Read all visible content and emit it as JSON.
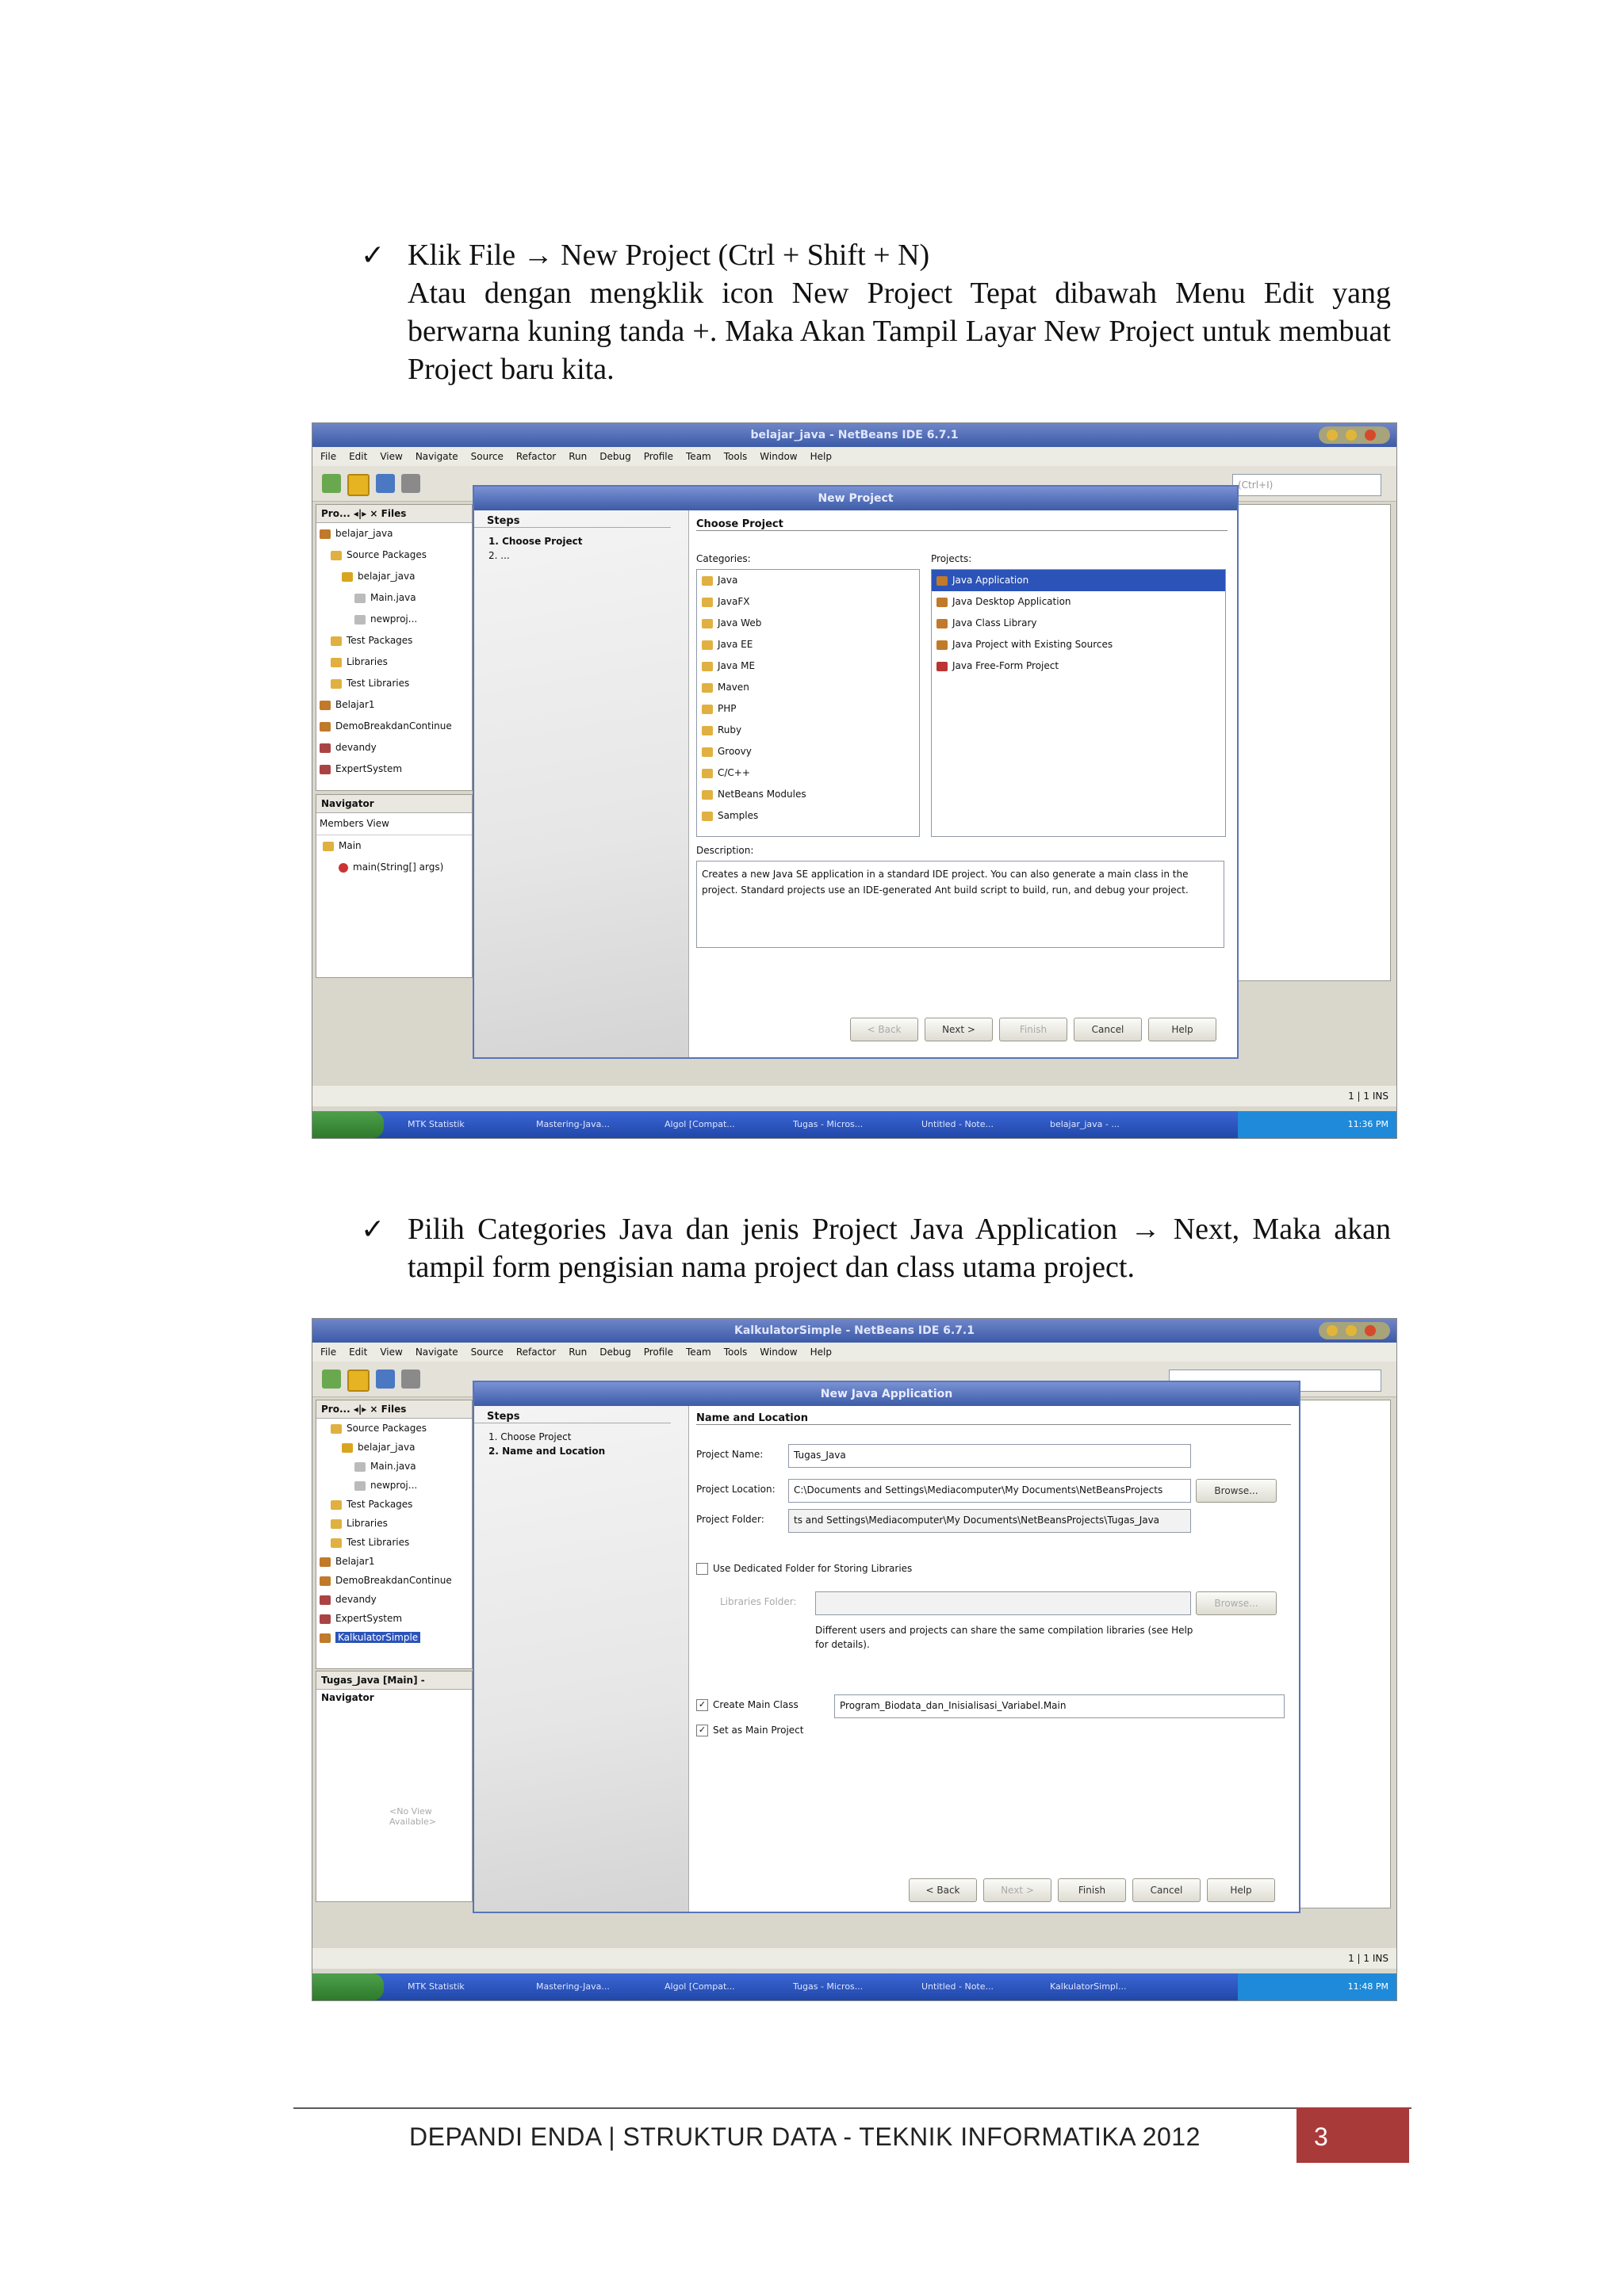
{
  "section1": {
    "check": "✓",
    "title": "Klik File → New Project (Ctrl + Shift + N)",
    "body": "Atau dengan mengklik icon New Project Tepat dibawah Menu Edit yang berwarna kuning tanda +. Maka Akan Tampil Layar New Project untuk membuat Project baru kita."
  },
  "section2": {
    "check": "✓",
    "body": "Pilih Categories Java dan jenis Project Java Application  → Next, Maka akan tampil form pengisian nama project dan class utama project."
  },
  "ide_menu": [
    "File",
    "Edit",
    "View",
    "Navigate",
    "Source",
    "Refactor",
    "Run",
    "Debug",
    "Profile",
    "Team",
    "Tools",
    "Window",
    "Help"
  ],
  "shot1": {
    "title": "belajar_java - NetBeans IDE 6.7.1",
    "tabs": "Pro...  ◂|▸ ×  Files",
    "tree": [
      "belajar_java",
      "Source Packages",
      "belajar_java",
      "Main.java",
      "newproj...",
      "Test Packages",
      "Libraries",
      "Test Libraries",
      "Belajar1",
      "DemoBreakdanContinue",
      "devandy",
      "ExpertSystem"
    ],
    "navigator": "Navigator",
    "members_view": "Members View",
    "nav_tree": [
      "Main",
      "main(String[] args)"
    ],
    "search_hint": "(Ctrl+I)",
    "dialog": {
      "title": "New Project",
      "steps_header": "Steps",
      "steps": [
        "1.   Choose Project",
        "2.   ..."
      ],
      "section": "Choose Project",
      "categories_label": "Categories:",
      "categories": [
        "Java",
        "JavaFX",
        "Java Web",
        "Java EE",
        "Java ME",
        "Maven",
        "PHP",
        "Ruby",
        "Groovy",
        "C/C++",
        "NetBeans Modules",
        "Samples"
      ],
      "projects_label": "Projects:",
      "projects": [
        "Java Application",
        "Java Desktop Application",
        "Java Class Library",
        "Java Project with Existing Sources",
        "Java Free-Form Project"
      ],
      "description_label": "Description:",
      "description": "Creates a new Java SE application in a standard IDE project. You can also generate a main class in the project. Standard projects use an IDE-generated Ant build script to build, run, and debug your project.",
      "buttons": [
        "< Back",
        "Next >",
        "Finish",
        "Cancel",
        "Help"
      ]
    },
    "status": "1 | 1    INS",
    "taskbar": [
      "MTK Statistik",
      "Mastering-Java...",
      "Algol [Compat...",
      "Tugas - Micros...",
      "Untitled - Note...",
      "belajar_java - ..."
    ],
    "clock": "11:36 PM"
  },
  "shot2": {
    "title": "KalkulatorSimple - NetBeans IDE 6.7.1",
    "tabs": "Pro...  ◂|▸ ×  Files",
    "tree": [
      "Source Packages",
      "belajar_java",
      "Main.java",
      "newproj...",
      "Test Packages",
      "Libraries",
      "Test Libraries",
      "Belajar1",
      "DemoBreakdanContinue",
      "devandy",
      "ExpertSystem",
      "KalkulatorSimple"
    ],
    "navigator": "Tugas_Java [Main] - Navigator",
    "no_view": "<No View Available>",
    "dialog": {
      "title": "New Java Application",
      "steps_header": "Steps",
      "steps": [
        "1.   Choose Project",
        "2.   Name and Location"
      ],
      "section": "Name and Location",
      "project_name_label": "Project Name:",
      "project_name": "Tugas_Java",
      "project_location_label": "Project Location:",
      "project_location": "C:\\Documents and Settings\\Mediacomputer\\My Documents\\NetBeansProjects",
      "browse": "Browse...",
      "project_folder_label": "Project Folder:",
      "project_folder": "ts and Settings\\Mediacomputer\\My Documents\\NetBeansProjects\\Tugas_Java",
      "dedicated_folder": "Use Dedicated Folder for Storing Libraries",
      "libraries_folder_label": "Libraries Folder:",
      "browse2": "Browse...",
      "shared_note": "Different users and projects can share the same compilation libraries (see Help for details).",
      "create_main_class": "Create Main Class",
      "main_class": "Program_Biodata_dan_Inisialisasi_Variabel.Main",
      "set_main_project": "Set as Main Project",
      "buttons": [
        "< Back",
        "Next >",
        "Finish",
        "Cancel",
        "Help"
      ]
    },
    "status": "1 | 1    INS",
    "taskbar": [
      "MTK Statistik",
      "Mastering-Java...",
      "Algol [Compat...",
      "Tugas - Micros...",
      "Untitled - Note...",
      "KalkulatorSimpl..."
    ],
    "clock": "11:48 PM"
  },
  "footer": {
    "text": "DEPANDI ENDA | STRUKTUR DATA - TEKNIK INFORMATIKA 2012",
    "page": "3"
  }
}
